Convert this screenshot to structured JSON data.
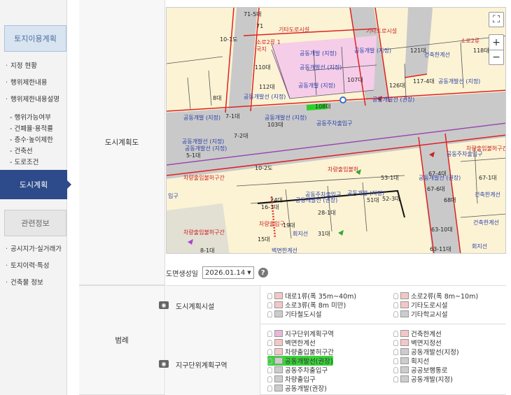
{
  "sidebar": {
    "header_land": "토지이용계획",
    "items": [
      {
        "label": "지정 현황"
      },
      {
        "label": "행위제한내용"
      },
      {
        "label": "행위제한내용설명"
      }
    ],
    "subitems": [
      {
        "label": "- 행위가능여부"
      },
      {
        "label": "- 건폐율·용적률"
      },
      {
        "label": "- 층수·높이제한"
      },
      {
        "label": "- 건축선"
      },
      {
        "label": "- 도로조건"
      }
    ],
    "active": "도시계획",
    "header_related": "관련정보",
    "related": [
      {
        "label": "공시지가·실거래가"
      },
      {
        "label": "토지이력·특성"
      },
      {
        "label": "건축물 정보"
      }
    ]
  },
  "main": {
    "plan_label": "도시계획도",
    "legend_label": "범례",
    "date_label": "도면생성일",
    "date_value": "2026.01.14",
    "help": "?"
  },
  "map": {
    "labels": [
      {
        "t": "71-5대"
      },
      {
        "t": "71"
      },
      {
        "t": "기타도로시설"
      },
      {
        "t": "기타도로시설"
      },
      {
        "t": "소로2류"
      },
      {
        "t": "10-1도"
      },
      {
        "t": "소로2류 1"
      },
      {
        "t": "국지"
      },
      {
        "t": "공동개발 (지정)"
      },
      {
        "t": "공동개발 (지정)"
      },
      {
        "t": "121대"
      },
      {
        "t": "118대"
      },
      {
        "t": "건축한계선"
      },
      {
        "t": "110대"
      },
      {
        "t": "공동개발선 (지정)"
      },
      {
        "t": "112대"
      },
      {
        "t": "공동개발 (지정)"
      },
      {
        "t": "107대"
      },
      {
        "t": "126대"
      },
      {
        "t": "117-4대"
      },
      {
        "t": "공동개발선 (지정)"
      },
      {
        "t": "8대"
      },
      {
        "t": "공동개발선 (지정)"
      },
      {
        "t": "공동개발선 (권장)"
      },
      {
        "t": "7-1대"
      },
      {
        "t": "공동개발 (지정)"
      },
      {
        "t": "7-2대"
      },
      {
        "t": "108대"
      },
      {
        "t": "공동개발선 (지정)"
      },
      {
        "t": "103대"
      },
      {
        "t": "공동주차출입구"
      },
      {
        "t": "공동개발선 (지정)"
      },
      {
        "t": "공동개발선 (지정)"
      },
      {
        "t": "5-1대"
      },
      {
        "t": "10-2도"
      },
      {
        "t": "차량출입불허구간"
      },
      {
        "t": "차량출입불허구간"
      },
      {
        "t": "공동주차출입구"
      },
      {
        "t": "차량출입불허"
      },
      {
        "t": "67-4대"
      },
      {
        "t": "67-1대"
      },
      {
        "t": "53-1대"
      },
      {
        "t": "67-6대"
      },
      {
        "t": "68대"
      },
      {
        "t": "건축한계선"
      },
      {
        "t": "공동주차출입구"
      },
      {
        "t": "공동개발 (지정)"
      },
      {
        "t": "51대"
      },
      {
        "t": "52-3대"
      },
      {
        "t": "공동개발선 (권장)"
      },
      {
        "t": "공동개발선 (권장)"
      },
      {
        "t": "16-3대"
      },
      {
        "t": "24대"
      },
      {
        "t": "28-1대"
      },
      {
        "t": "차량출입구"
      },
      {
        "t": "19대"
      },
      {
        "t": "15대"
      },
      {
        "t": "회지선"
      },
      {
        "t": "31대"
      },
      {
        "t": "차량출입불허구간"
      },
      {
        "t": "벽면한계선"
      },
      {
        "t": "8-1대"
      },
      {
        "t": "건축한계선"
      },
      {
        "t": "63-10대"
      },
      {
        "t": "63-11대"
      },
      {
        "t": "회지선"
      },
      {
        "t": "입구"
      }
    ]
  },
  "legend": {
    "group1": {
      "label": "도시계획시설",
      "items": [
        {
          "label": "대로1류(폭 35m~40m)",
          "color": "#f4c7c7"
        },
        {
          "label": "소로2류(폭 8m~10m)",
          "color": "#f4c7c7"
        },
        {
          "label": "소로3류(폭 8m 미만)",
          "color": "#f4c7c7"
        },
        {
          "label": "기타도로시설",
          "color": "#f4c7c7"
        },
        {
          "label": "기타철도시설",
          "color": "#cccccc"
        },
        {
          "label": "기타학교시설",
          "color": "#cccccc"
        }
      ]
    },
    "group2": {
      "label": "지구단위계획구역",
      "items": [
        {
          "label": "지구단위계획구역",
          "color": "#e8b8d8"
        },
        {
          "label": "건축한계선",
          "color": "#f4c7c7"
        },
        {
          "label": "벽면한계선",
          "color": "#f4c7c7"
        },
        {
          "label": "벽면지정선",
          "color": "#f4c7c7"
        },
        {
          "label": "차량출입불허구간",
          "color": "#f4c7c7"
        },
        {
          "label": "공동개발선(지정)",
          "color": "#cccccc"
        },
        {
          "label": "공동개발선(권장)",
          "color": "#cccccc"
        },
        {
          "label": "획지선",
          "color": "#cccccc"
        },
        {
          "label": "공동주차출입구",
          "color": "#cccccc"
        },
        {
          "label": "공공보행통로",
          "color": "#cccccc"
        },
        {
          "label": "차량출입구",
          "color": "#cccccc"
        },
        {
          "label": "공동개발(지정)",
          "color": "#cccccc"
        },
        {
          "label": "공동개발(권장)",
          "color": "#cccccc"
        }
      ]
    }
  }
}
